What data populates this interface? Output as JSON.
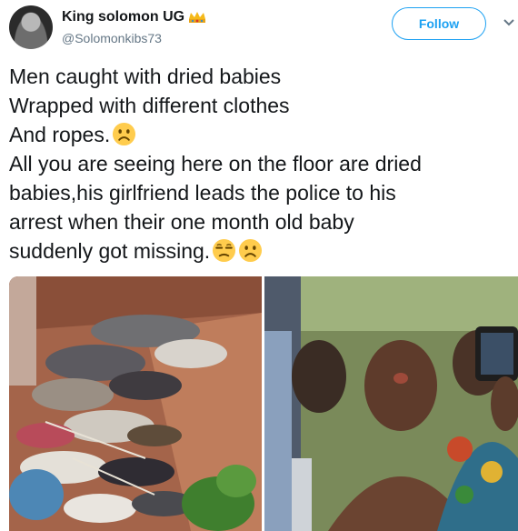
{
  "tweet": {
    "author_name": "King solomon UG",
    "author_handle": "@Solomonkibs73",
    "follow_label": "Follow",
    "lines": [
      "Men caught with dried babies",
      "Wrapped with different clothes",
      "And ropes.",
      "All you are seeing here on the floor are dried",
      "babies,his girlfriend leads the police to his",
      "arrest when their one month old baby",
      "suddenly got missing."
    ],
    "emojis": [
      "frowning-face",
      "unamused-face",
      "frowning-face"
    ]
  },
  "colors": {
    "accent": "#1da1f2",
    "handle": "#657786",
    "text": "#14171a"
  }
}
